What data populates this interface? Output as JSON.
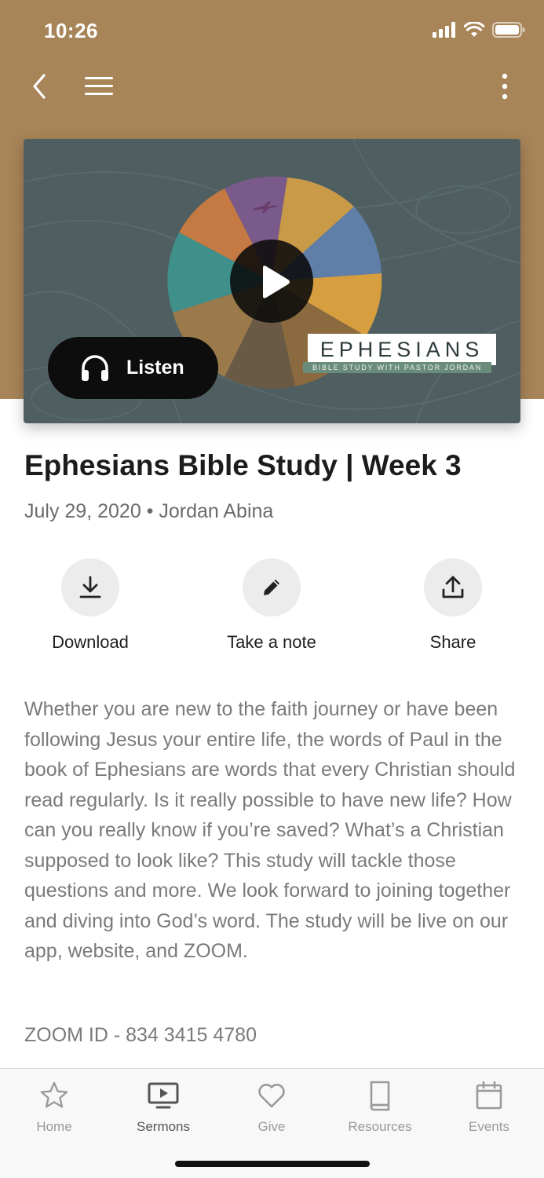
{
  "status_bar": {
    "time": "10:26"
  },
  "nav": {
    "back_icon": "chevron-left-icon",
    "menu_icon": "hamburger-icon",
    "more_icon": "vertical-dots-icon"
  },
  "media": {
    "listen_label": "Listen",
    "artwork_title": "EPHESIANS",
    "artwork_subtitle": "BIBLE STUDY WITH PASTOR JORDAN"
  },
  "sermon": {
    "title": "Ephesians Bible Study | Week 3",
    "meta": "July 29, 2020 • Jordan Abina",
    "description": "Whether you are new to the faith journey or have been following Jesus your entire life, the words of Paul in the book of Ephesians are words that every Christian should read regularly. Is it really possible to have new life? How can you really know if you’re saved? What’s a Christian supposed to look like? This study will tackle those questions and more. We look forward to joining together and diving into God’s word. The study will be live on our app, website, and ZOOM.",
    "zoom_id": "ZOOM ID - 834 3415 4780"
  },
  "actions": [
    {
      "label": "Download",
      "icon": "download-icon"
    },
    {
      "label": "Take a note",
      "icon": "pencil-icon"
    },
    {
      "label": "Share",
      "icon": "share-icon"
    }
  ],
  "tabs": [
    {
      "label": "Home",
      "icon": "star-icon",
      "active": false
    },
    {
      "label": "Sermons",
      "icon": "tv-play-icon",
      "active": true
    },
    {
      "label": "Give",
      "icon": "heart-icon",
      "active": false
    },
    {
      "label": "Resources",
      "icon": "book-icon",
      "active": false
    },
    {
      "label": "Events",
      "icon": "calendar-icon",
      "active": false
    }
  ],
  "colors": {
    "header_bg": "#a88558",
    "tab_active": "#555555",
    "tab_inactive": "#9a9a9a",
    "body_text": "#7a7a7a"
  }
}
